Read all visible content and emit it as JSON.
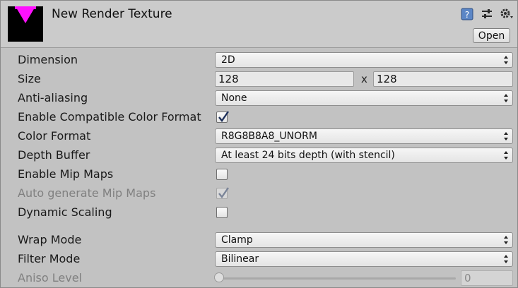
{
  "header": {
    "title": "New Render Texture",
    "open_label": "Open",
    "icons": [
      "help-icon",
      "preset-icon",
      "gear-icon"
    ],
    "thumbnail_color": "#ff10ff"
  },
  "fields": {
    "dimension": {
      "label": "Dimension",
      "value": "2D"
    },
    "size": {
      "label": "Size",
      "width": "128",
      "separator": "x",
      "height": "128"
    },
    "anti_aliasing": {
      "label": "Anti-aliasing",
      "value": "None"
    },
    "compatible_color_format": {
      "label": "Enable Compatible Color Format",
      "checked": true
    },
    "color_format": {
      "label": "Color Format",
      "value": "R8G8B8A8_UNORM"
    },
    "depth_buffer": {
      "label": "Depth Buffer",
      "value": "At least 24 bits depth (with stencil)"
    },
    "mip_maps": {
      "label": "Enable Mip Maps",
      "checked": false
    },
    "auto_mip_maps": {
      "label": "Auto generate Mip Maps",
      "checked": true,
      "disabled": true
    },
    "dynamic_scaling": {
      "label": "Dynamic Scaling",
      "checked": false
    },
    "wrap_mode": {
      "label": "Wrap Mode",
      "value": "Clamp"
    },
    "filter_mode": {
      "label": "Filter Mode",
      "value": "Bilinear"
    },
    "aniso_level": {
      "label": "Aniso Level",
      "value": "0",
      "disabled": true
    }
  }
}
